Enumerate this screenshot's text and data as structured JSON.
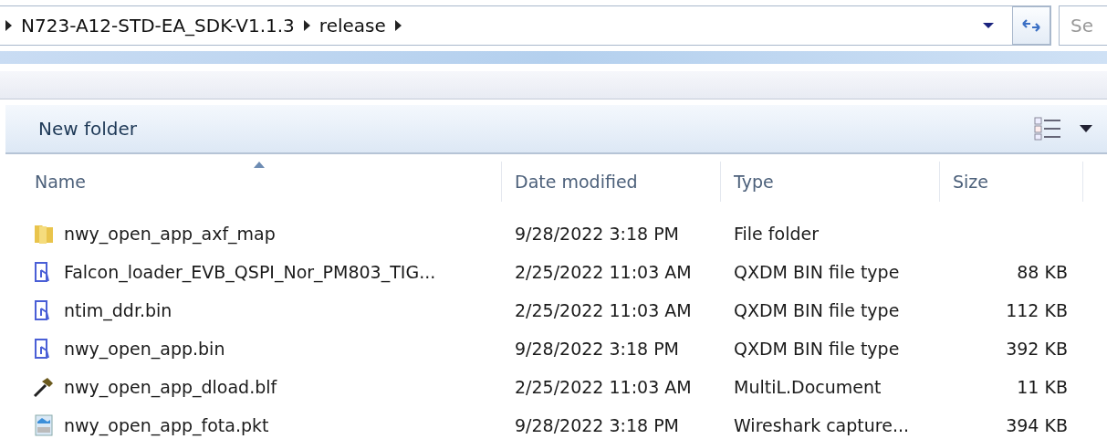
{
  "address_bar": {
    "crumbs": [
      "N723-A12-STD-EA_SDK-V1.1.3",
      "release"
    ]
  },
  "search": {
    "placeholder": "Se"
  },
  "toolbar": {
    "new_folder": "New folder"
  },
  "table": {
    "columns": [
      {
        "label": "Name",
        "sorted": true
      },
      {
        "label": "Date modified",
        "sorted": false
      },
      {
        "label": "Type",
        "sorted": false
      },
      {
        "label": "Size",
        "sorted": false
      }
    ],
    "rows": [
      {
        "kind": "folder",
        "name": "nwy_open_app_axf_map",
        "date": "9/28/2022 3:18 PM",
        "type": "File folder",
        "size": ""
      },
      {
        "kind": "bin",
        "name": "Falcon_loader_EVB_QSPI_Nor_PM803_TIG...",
        "date": "2/25/2022 11:03 AM",
        "type": "QXDM BIN file type",
        "size": "88 KB"
      },
      {
        "kind": "bin",
        "name": "ntim_ddr.bin",
        "date": "2/25/2022 11:03 AM",
        "type": "QXDM BIN file type",
        "size": "112 KB"
      },
      {
        "kind": "bin",
        "name": "nwy_open_app.bin",
        "date": "9/28/2022 3:18 PM",
        "type": "QXDM BIN file type",
        "size": "392 KB"
      },
      {
        "kind": "tool",
        "name": "nwy_open_app_dload.blf",
        "date": "2/25/2022 11:03 AM",
        "type": "MultiL.Document",
        "size": "11 KB"
      },
      {
        "kind": "capture",
        "name": "nwy_open_app_fota.pkt",
        "date": "9/28/2022 3:18 PM",
        "type": "Wireshark capture...",
        "size": "394 KB"
      }
    ]
  }
}
